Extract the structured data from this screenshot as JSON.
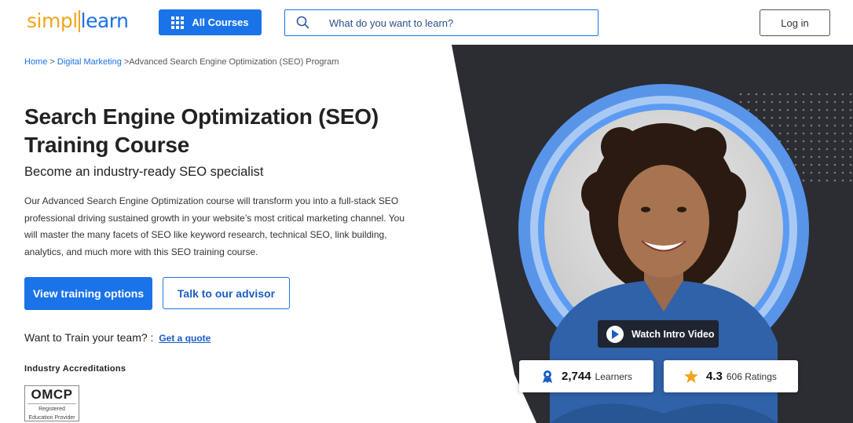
{
  "header": {
    "logo_part1": "simpl",
    "logo_part2": "learn",
    "all_courses_label": "All Courses",
    "search_placeholder": "What do you want to learn?",
    "login_label": "Log in"
  },
  "breadcrumb": {
    "home": "Home",
    "sep1": " > ",
    "category": "Digital Marketing",
    "sep2": " >",
    "current": "Advanced Search Engine Optimization (SEO) Program"
  },
  "hero": {
    "title_line1": "Search Engine Optimization (SEO)",
    "title_line2": "Training Course",
    "subtitle": "Become an industry-ready SEO specialist",
    "description": "Our Advanced Search Engine Optimization course will transform you into a full-stack SEO professional driving sustained growth in your website’s most critical marketing channel. You will master the many facets of SEO like keyword research, technical SEO, link building, analytics, and much more with this SEO training course.",
    "primary_button": "View training options",
    "secondary_button": "Talk to our advisor",
    "team_text": "Want to Train your team? :",
    "quote_link": "Get a quote",
    "accreditations_heading": "Industry Accreditations",
    "omcp_text": "OMCP",
    "omcp_sub1": "Registered",
    "omcp_sub2": "Education Provider"
  },
  "video": {
    "watch_label": "Watch Intro Video"
  },
  "stats": {
    "learners_count": "2,744",
    "learners_label": "Learners",
    "rating_value": "4.3",
    "ratings_label": "606 Ratings"
  },
  "colors": {
    "brand_blue": "#1a73e8",
    "brand_orange": "#f4a51c",
    "dark_panel": "#2b2d33",
    "star": "#f4a51c"
  }
}
